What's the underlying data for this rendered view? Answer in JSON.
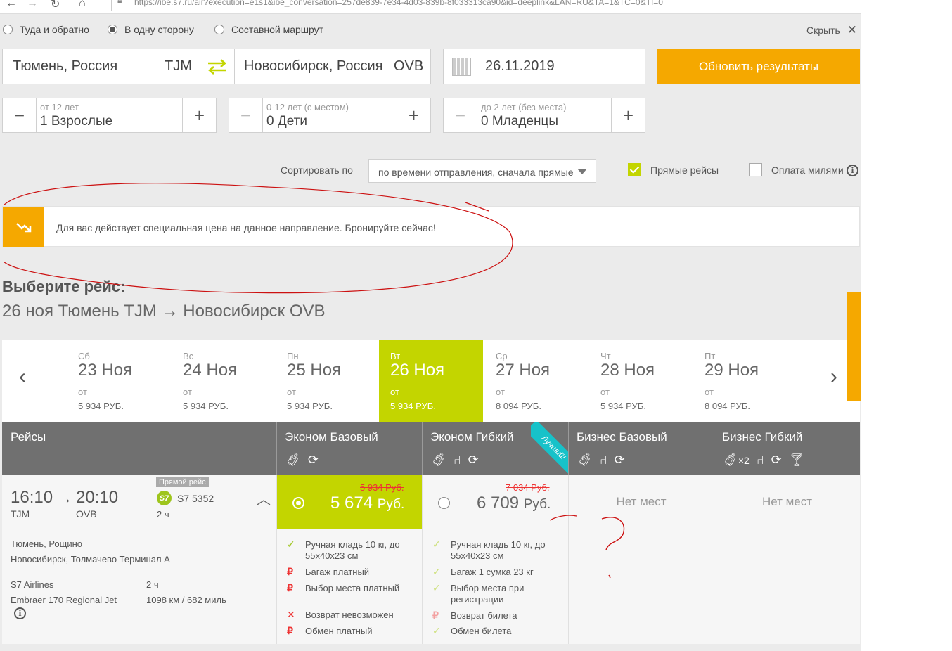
{
  "browser": {
    "url": "https://ibe.s7.ru/air?execution=e1s1&ibe_conversation=257de839-7e34-4d03-839b-8f033313ca90&id=deeplink&LAN=RU&TA=1&TC=0&TI=0"
  },
  "trip_type": {
    "options": [
      "Туда и обратно",
      "В одну сторону",
      "Составной маршрут"
    ],
    "selected": "В одну сторону",
    "hide_label": "Скрыть"
  },
  "search": {
    "origin": "Тюмень, Россия",
    "origin_code": "TJM",
    "destination": "Новосибирск, Россия",
    "destination_code": "OVB",
    "date": "26.11.2019",
    "submit_label": "Обновить результаты"
  },
  "passengers": [
    {
      "hint": "от 12 лет",
      "value": "1 Взрослые"
    },
    {
      "hint": "0-12 лет (с местом)",
      "value": "0 Дети"
    },
    {
      "hint": "до 2 лет (без места)",
      "value": "0 Младенцы"
    }
  ],
  "sort": {
    "label": "Сортировать по",
    "selected": "по времени отправления, сначала прямые",
    "direct_label": "Прямые рейсы",
    "direct_checked": true,
    "miles_label": "Оплата милями",
    "miles_checked": false
  },
  "promo": {
    "text": "Для вас действует специальная цена на данное направление. Бронируйте сейчас!"
  },
  "heading": {
    "title": "Выберите рейс:",
    "date": "26 ноя",
    "from_city": "Тюмень",
    "from_code": "TJM",
    "arrow": "→",
    "to_city": "Новосибирск",
    "to_code": "OVB"
  },
  "dates": [
    {
      "dow": "Сб",
      "day": "23 Ноя",
      "from": "от",
      "price": "5 934 РУБ."
    },
    {
      "dow": "Вс",
      "day": "24 Ноя",
      "from": "от",
      "price": "5 934 РУБ."
    },
    {
      "dow": "Пн",
      "day": "25 Ноя",
      "from": "от",
      "price": "5 934 РУБ."
    },
    {
      "dow": "Вт",
      "day": "26 Ноя",
      "from": "от",
      "price": "5 934 РУБ."
    },
    {
      "dow": "Ср",
      "day": "27 Ноя",
      "from": "от",
      "price": "8 094 РУБ."
    },
    {
      "dow": "Чт",
      "day": "28 Ноя",
      "from": "от",
      "price": "5 934 РУБ."
    },
    {
      "dow": "Пт",
      "day": "29 Ноя",
      "from": "от",
      "price": "8 094 РУБ."
    }
  ],
  "selected_date_index": 3,
  "table": {
    "flights_header": "Рейсы",
    "fares": [
      "Эконом Базовый",
      "Эконом Гибкий",
      "Бизнес Базовый",
      "Бизнес Гибкий"
    ],
    "best_label": "Лучший!",
    "baggage_multiplier": "×2"
  },
  "flight": {
    "dep_time": "16:10",
    "arr_time": "20:10",
    "dep_code": "TJM",
    "arr_code": "OVB",
    "direct_badge": "Прямой рейс",
    "airline_logo": "S7",
    "flight_no": "S7 5352",
    "duration": "2 ч",
    "dep_airport": "Тюмень, Рощино",
    "arr_airport": "Новосибирск, Толмачево Терминал А",
    "carrier": "S7 Airlines",
    "duration2": "2 ч",
    "aircraft": "Embraer 170 Regional Jet",
    "distance": "1098 км / 682 миль"
  },
  "fares": {
    "eco_basic": {
      "old_price": "5 934 Руб.",
      "price": "5 674",
      "currency": "Руб.",
      "features": [
        "Ручная кладь 10 кг, до 55x40x23 см",
        "Багаж платный",
        "Выбор места платный",
        "Возврат невозможен",
        "Обмен платный"
      ]
    },
    "eco_flex": {
      "old_price": "7 034 Руб.",
      "price": "6 709",
      "currency": "Руб.",
      "features": [
        "Ручная кладь 10 кг, до 55x40x23 см",
        "Багаж 1 сумка 23 кг",
        "Выбор места при регистрации",
        "Возврат билета",
        "Обмен билета"
      ]
    },
    "no_seats": "Нет мест"
  },
  "colors": {
    "accent_orange": "#f5a800",
    "accent_green": "#c3d500",
    "header_gray": "#707070",
    "annotation_red": "#cc1111"
  }
}
